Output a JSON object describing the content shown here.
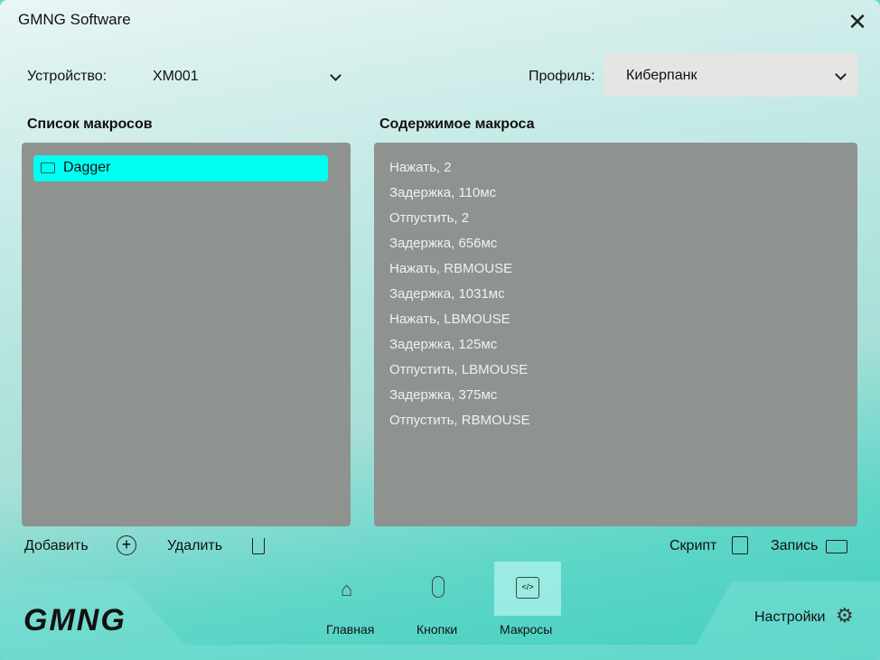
{
  "window": {
    "title": "GMNG Software"
  },
  "device": {
    "label": "Устройство:",
    "value": "XM001"
  },
  "profile": {
    "label": "Профиль:",
    "value": "Киберпанк"
  },
  "macro_list": {
    "title": "Список макросов",
    "items": [
      {
        "name": "Dagger",
        "selected": true
      }
    ]
  },
  "macro_content": {
    "title": "Содержимое макроса",
    "steps": [
      "Нажать, 2",
      "Задержка, 110мс",
      "Отпустить, 2",
      "Задержка, 656мс",
      "Нажать, RBMOUSE",
      "Задержка, 1031мс",
      "Нажать, LBMOUSE",
      "Задержка, 125мс",
      "Отпустить, LBMOUSE",
      "Задержка, 375мс",
      "Отпустить, RBMOUSE"
    ]
  },
  "actions": {
    "add": "Добавить",
    "delete": "Удалить",
    "script": "Скрипт",
    "record": "Запись"
  },
  "nav": {
    "logo": "GMNG",
    "items": [
      {
        "label": "Главная"
      },
      {
        "label": "Кнопки"
      },
      {
        "label": "Макросы",
        "active": true
      }
    ],
    "settings": "Настройки"
  }
}
